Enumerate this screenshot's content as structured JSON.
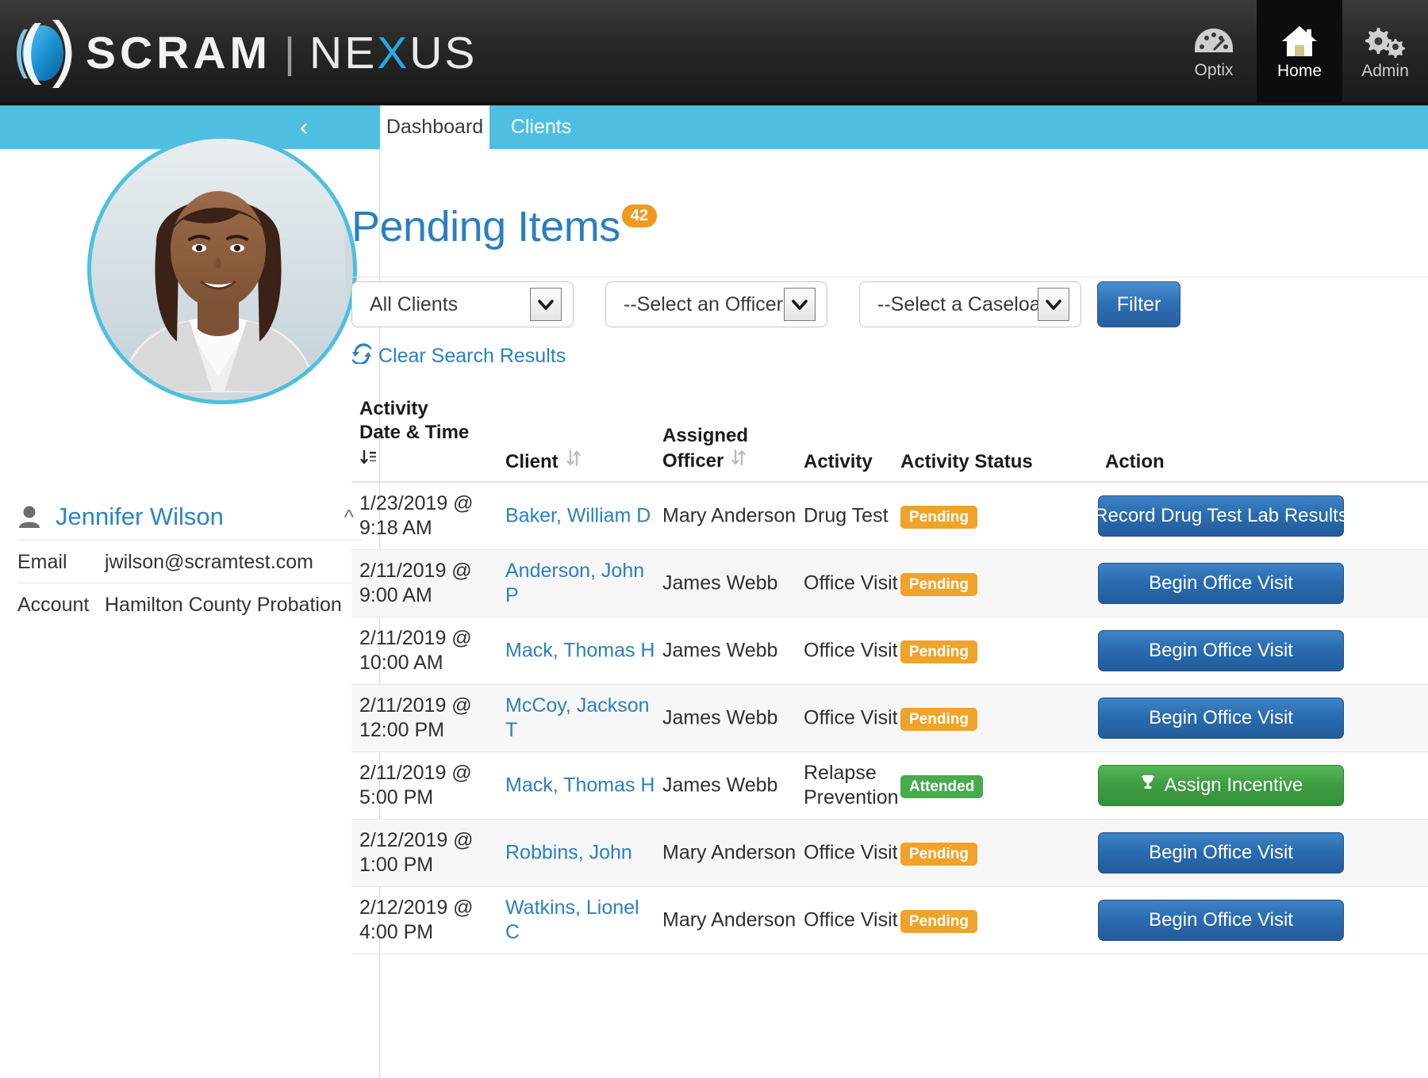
{
  "brand": {
    "logo_icon": "scram-swoosh-logo",
    "name_primary": "SCRAM",
    "separator": "|",
    "name_secondary_pre": "NE",
    "name_secondary_x": "X",
    "name_secondary_post": "US"
  },
  "topnav": {
    "items": [
      {
        "label": "Optix",
        "icon": "gauge-icon",
        "active": false
      },
      {
        "label": "Home",
        "icon": "home-icon",
        "active": true
      },
      {
        "label": "Admin",
        "icon": "gears-icon",
        "active": false
      }
    ]
  },
  "sidebar": {
    "collapse_icon": "chevron-left-icon",
    "avatar_name": "Jennifer Wilson",
    "user_icon": "person-icon",
    "user_chevron": "chevron-up-icon",
    "fields": [
      {
        "key": "Email",
        "value": "jwilson@scramtest.com"
      },
      {
        "key": "Account",
        "value": "Hamilton County Probation"
      }
    ]
  },
  "tabs": [
    {
      "label": "Dashboard",
      "active": true
    },
    {
      "label": "Clients",
      "active": false
    }
  ],
  "page": {
    "title": "Pending Items",
    "badge": "42"
  },
  "filters": {
    "client_select": "All Clients",
    "officer_select": "--Select an Officer--",
    "caseload_select": "--Select a Caseload--",
    "filter_button": "Filter",
    "clear_link": "Clear Search Results",
    "clear_icon": "refresh-icon",
    "dropdown_icon": "chevron-down-icon"
  },
  "table": {
    "headers": {
      "date_line1": "Activity",
      "date_line2": "Date & Time",
      "date_sort_icon": "sort-ascending-icon",
      "client": "Client",
      "client_sort_icon": "sort-updown-icon",
      "officer_line1": "Assigned",
      "officer_line2": "Officer",
      "officer_sort_icon": "sort-updown-icon",
      "activity": "Activity",
      "status": "Activity Status",
      "action": "Action"
    },
    "rows": [
      {
        "date": "1/23/2019 @",
        "time": "9:18 AM",
        "client": "Baker, William D",
        "officer": "Mary Anderson",
        "activity": "Drug Test",
        "activity2": "",
        "status": "Pending",
        "status_kind": "pending",
        "action": "Record Drug Test Lab Results",
        "action_kind": "blue",
        "action_icon": ""
      },
      {
        "date": "2/11/2019 @",
        "time": "9:00 AM",
        "client": "Anderson, John P",
        "officer": "James Webb",
        "activity": "Office Visit",
        "activity2": "",
        "status": "Pending",
        "status_kind": "pending",
        "action": "Begin Office Visit",
        "action_kind": "blue",
        "action_icon": ""
      },
      {
        "date": "2/11/2019 @",
        "time": "10:00 AM",
        "client": "Mack, Thomas H",
        "officer": "James Webb",
        "activity": "Office Visit",
        "activity2": "",
        "status": "Pending",
        "status_kind": "pending",
        "action": "Begin Office Visit",
        "action_kind": "blue",
        "action_icon": ""
      },
      {
        "date": "2/11/2019 @",
        "time": "12:00 PM",
        "client": "McCoy, Jackson T",
        "officer": "James Webb",
        "activity": "Office Visit",
        "activity2": "",
        "status": "Pending",
        "status_kind": "pending",
        "action": "Begin Office Visit",
        "action_kind": "blue",
        "action_icon": ""
      },
      {
        "date": "2/11/2019 @",
        "time": "5:00 PM",
        "client": "Mack, Thomas H",
        "officer": "James Webb",
        "activity": "Relapse",
        "activity2": "Prevention",
        "status": "Attended",
        "status_kind": "attended",
        "action": "Assign Incentive",
        "action_kind": "green",
        "action_icon": "trophy-icon"
      },
      {
        "date": "2/12/2019 @",
        "time": "1:00 PM",
        "client": "Robbins, John",
        "officer": "Mary Anderson",
        "activity": "Office Visit",
        "activity2": "",
        "status": "Pending",
        "status_kind": "pending",
        "action": "Begin Office Visit",
        "action_kind": "blue",
        "action_icon": ""
      },
      {
        "date": "2/12/2019 @",
        "time": "4:00 PM",
        "client": "Watkins, Lionel C",
        "officer": "Mary Anderson",
        "activity": "Office Visit",
        "activity2": "",
        "status": "Pending",
        "status_kind": "pending",
        "action": "Begin Office Visit",
        "action_kind": "blue",
        "action_icon": ""
      }
    ]
  },
  "colors": {
    "accent_cyan": "#4ebfe0",
    "link_blue": "#2b7fc0",
    "badge_orange": "#ef9a1f",
    "status_pending": "#efa32a",
    "status_attended": "#47ab4b",
    "button_blue": "#2a6cb0",
    "button_green": "#3d9c41",
    "topbar_dark": "#262626"
  }
}
